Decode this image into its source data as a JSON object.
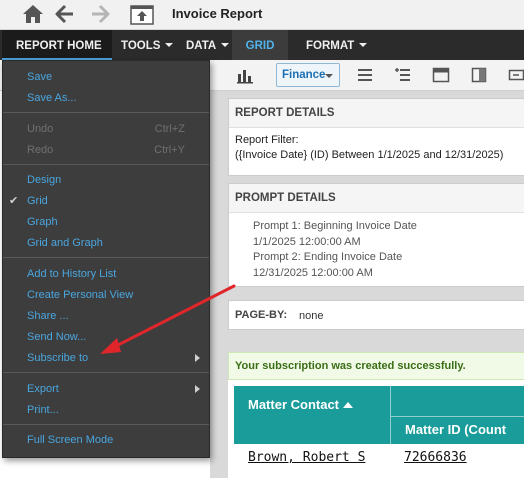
{
  "title_bar": {
    "report_title": "Invoice Report"
  },
  "menu_bar": {
    "report_home": "REPORT HOME",
    "tools": "TOOLS",
    "data": "DATA",
    "grid": "GRID",
    "format": "FORMAT"
  },
  "toolbar": {
    "finance": "Finance"
  },
  "dropdown": {
    "save": "Save",
    "save_as": "Save As...",
    "undo": "Undo",
    "undo_shortcut": "Ctrl+Z",
    "redo": "Redo",
    "redo_shortcut": "Ctrl+Y",
    "design": "Design",
    "grid": "Grid",
    "graph": "Graph",
    "grid_and_graph": "Grid and Graph",
    "add_to_history": "Add to History List",
    "create_personal_view": "Create Personal View",
    "share": "Share ...",
    "send_now": "Send Now...",
    "subscribe_to": "Subscribe to",
    "export": "Export",
    "print": "Print...",
    "full_screen": "Full Screen Mode",
    "selected_view": "Grid"
  },
  "report_details": {
    "heading": "REPORT DETAILS",
    "filter_label": "Report Filter:",
    "filter_value": "({Invoice Date} (ID) Between 1/1/2025 and 12/31/2025)"
  },
  "prompt_details": {
    "heading": "PROMPT DETAILS",
    "lines": [
      "Prompt 1: Beginning Invoice Date",
      "1/1/2025 12:00:00 AM",
      "Prompt 2: Ending Invoice Date",
      "12/31/2025 12:00:00 AM"
    ]
  },
  "page_by": {
    "label": "PAGE-BY:",
    "value": "none"
  },
  "message": "Your subscription was created successfully.",
  "grid": {
    "col1_header": "Matter Contact",
    "col2_header": "Matter ID (Count",
    "rows": [
      {
        "contact": "Brown, Robert S",
        "matter_id": "72666836"
      }
    ]
  },
  "colors": {
    "menu_bar": "#2b2b2b",
    "dropdown": "#3d3d3d",
    "link_blue": "#4aa6df",
    "grid_header": "#1a9c9a",
    "arrow": "#e0262b"
  }
}
